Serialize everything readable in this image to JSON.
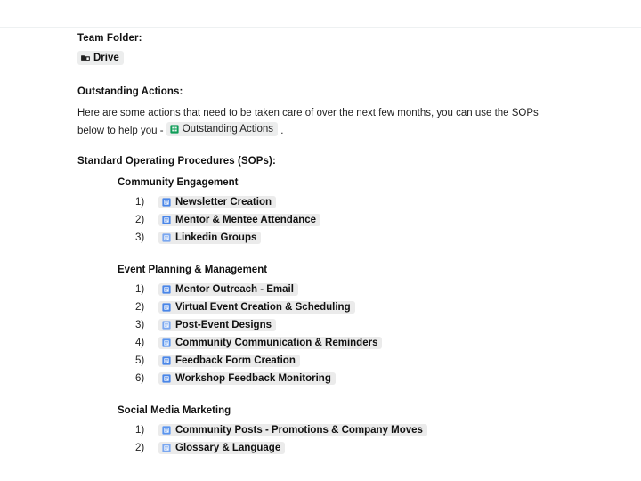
{
  "document": {
    "team_folder": {
      "heading": "Team Folder:",
      "chip": {
        "label": "Drive",
        "icon": "drive-folder-icon",
        "icon_color": "#1f1f1f"
      }
    },
    "outstanding_actions": {
      "heading": "Outstanding Actions:",
      "paragraph_before": "Here are some actions that need to be taken care of over the next few months, you can use the SOPs below to help you - ",
      "chip": {
        "label": "Outstanding Actions",
        "icon": "google-sheets-icon",
        "icon_color": "#0f9d58"
      },
      "paragraph_after": " ."
    },
    "sops": {
      "heading": "Standard Operating Procedures (SOPs):",
      "groups": [
        {
          "name": "Community Engagement",
          "items": [
            {
              "number": "1)",
              "label": "Newsletter Creation",
              "icon": "google-docs-icon",
              "icon_color": "#4a86e8"
            },
            {
              "number": "2)",
              "label": "Mentor & Mentee Attendance",
              "icon": "google-docs-icon",
              "icon_color": "#4a86e8"
            },
            {
              "number": "3)",
              "label": "Linkedin Groups",
              "icon": "google-docs-icon",
              "icon_color": "#7aa7f0"
            }
          ]
        },
        {
          "name": "Event Planning & Management",
          "items": [
            {
              "number": "1)",
              "label": "Mentor Outreach - Email",
              "icon": "google-docs-icon",
              "icon_color": "#4a86e8"
            },
            {
              "number": "2)",
              "label": "Virtual Event Creation & Scheduling",
              "icon": "google-docs-icon",
              "icon_color": "#4a86e8"
            },
            {
              "number": "3)",
              "label": "Post-Event Designs",
              "icon": "google-docs-icon",
              "icon_color": "#7aa7f0"
            },
            {
              "number": "4)",
              "label": "Community Communication & Reminders",
              "icon": "google-docs-icon",
              "icon_color": "#5b95ee"
            },
            {
              "number": "5)",
              "label": "Feedback Form Creation",
              "icon": "google-docs-icon",
              "icon_color": "#4a86e8"
            },
            {
              "number": "6)",
              "label": "Workshop Feedback Monitoring",
              "icon": "google-docs-icon",
              "icon_color": "#4a86e8"
            }
          ]
        },
        {
          "name": "Social Media Marketing",
          "items": [
            {
              "number": "1)",
              "label": "Community Posts - Promotions & Company Moves",
              "icon": "google-docs-icon",
              "icon_color": "#5b95ee"
            },
            {
              "number": "2)",
              "label": "Glossary & Language",
              "icon": "google-docs-icon",
              "icon_color": "#7aa7f0"
            }
          ]
        }
      ]
    }
  },
  "colors": {
    "page_background": "#ffffff",
    "text": "#1f1f1f",
    "chip_background": "#ebebeb",
    "divider": "#eef1f2"
  }
}
